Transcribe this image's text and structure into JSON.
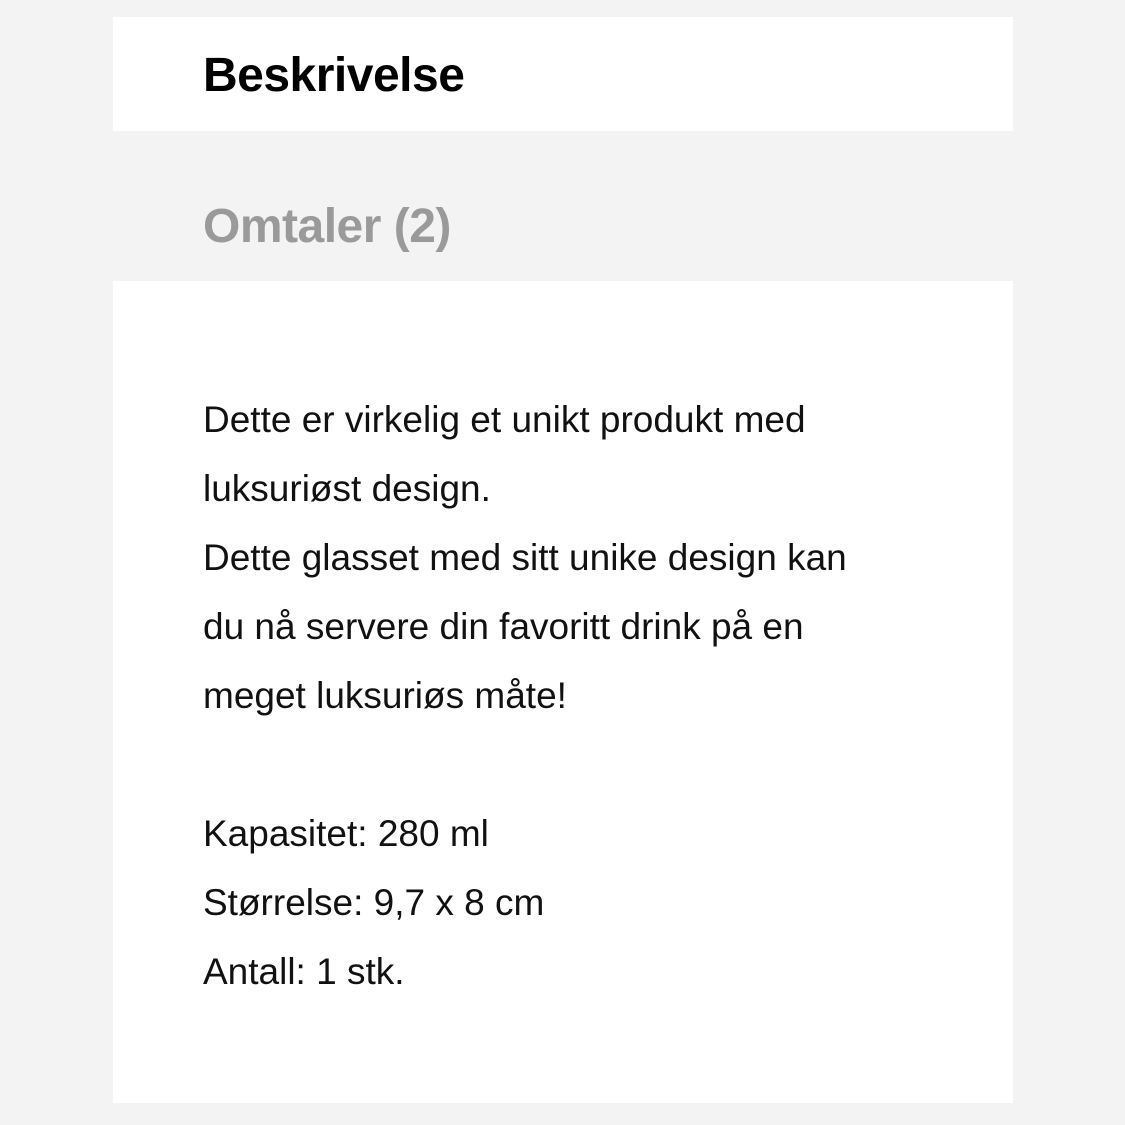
{
  "tabs": {
    "description_label": "Beskrivelse",
    "reviews_label": "Omtaler (2)"
  },
  "description": {
    "lines": [
      "Dette er virkelig et unikt produkt med",
      "luksuriøst design.",
      "Dette glasset med sitt unike design kan",
      "du nå servere din favoritt drink på en",
      "meget luksuriøs måte!"
    ],
    "specs": [
      "Kapasitet: 280 ml",
      "Størrelse: 9,7 x 8 cm",
      "Antall: 1 stk."
    ]
  },
  "colors": {
    "page_background": "#f3f3f3",
    "panel_background": "#ffffff",
    "active_tab_text": "#000000",
    "inactive_tab_text": "#9a9a9a"
  }
}
